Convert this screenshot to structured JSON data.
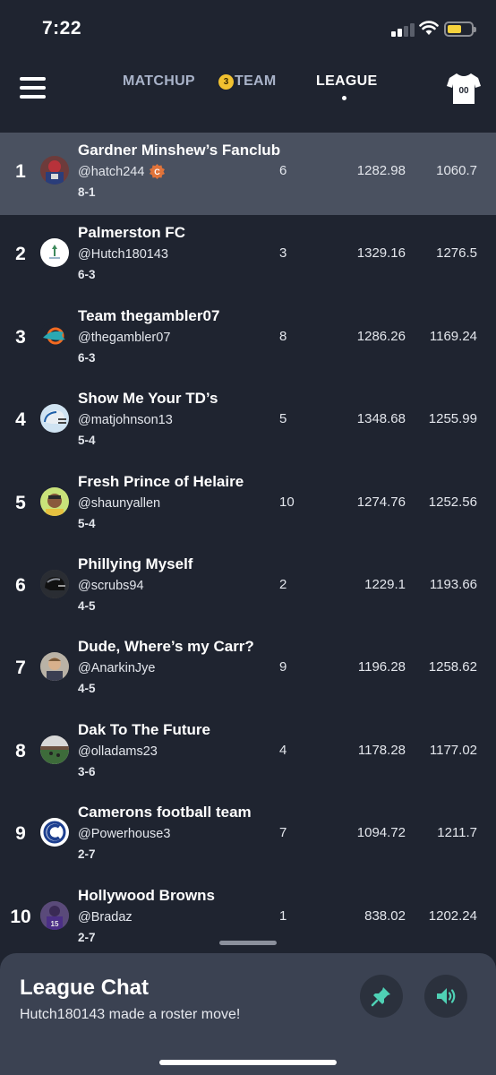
{
  "status_bar": {
    "time": "7:22"
  },
  "nav": {
    "tabs": [
      {
        "label": "MATCHUP",
        "active": false
      },
      {
        "label": "TEAM",
        "active": false,
        "badge": "3"
      },
      {
        "label": "LEAGUE",
        "active": true
      }
    ],
    "jersey_number": "00"
  },
  "colors": {
    "background": "#1f2430",
    "highlight_row": "#4a5160",
    "chat_panel": "#3b4252",
    "accent_teal": "#4fd1b5",
    "badge_yellow": "#f2c230",
    "commissioner_orange": "#e0733a"
  },
  "standings": [
    {
      "rank": "1",
      "team": "Gardner Minshew’s Fanclub",
      "handle": "@hatch244",
      "record": "8-1",
      "col_a": "6",
      "col_b": "1282.98",
      "col_c": "1060.7",
      "commissioner": true,
      "badge_letter": "C",
      "avatar": "football-player-avatar"
    },
    {
      "rank": "2",
      "team": "Palmerston FC",
      "handle": "@Hutch180143",
      "record": "6-3",
      "col_a": "3",
      "col_b": "1329.16",
      "col_c": "1276.5",
      "avatar": "club-crest-avatar"
    },
    {
      "rank": "3",
      "team": "Team thegambler07",
      "handle": "@thegambler07",
      "record": "6-3",
      "col_a": "8",
      "col_b": "1286.26",
      "col_c": "1169.24",
      "avatar": "dolphin-logo-avatar"
    },
    {
      "rank": "4",
      "team": "Show Me Your TD’s",
      "handle": "@matjohnson13",
      "record": "5-4",
      "col_a": "5",
      "col_b": "1348.68",
      "col_c": "1255.99",
      "avatar": "helmet-avatar"
    },
    {
      "rank": "5",
      "team": "Fresh Prince of Helaire",
      "handle": "@shaunyallen",
      "record": "5-4",
      "col_a": "10",
      "col_b": "1274.76",
      "col_c": "1252.56",
      "avatar": "cartoon-face-avatar"
    },
    {
      "rank": "6",
      "team": "Phillying Myself",
      "handle": "@scrubs94",
      "record": "4-5",
      "col_a": "2",
      "col_b": "1229.1",
      "col_c": "1193.66",
      "avatar": "dark-helmet-avatar"
    },
    {
      "rank": "7",
      "team": "Dude, Where’s my Carr?",
      "handle": "@AnarkinJye",
      "record": "4-5",
      "col_a": "9",
      "col_b": "1196.28",
      "col_c": "1258.62",
      "avatar": "quarterback-avatar"
    },
    {
      "rank": "8",
      "team": "Dak To The Future",
      "handle": "@olladams23",
      "record": "3-6",
      "col_a": "4",
      "col_b": "1178.28",
      "col_c": "1177.02",
      "avatar": "stadium-avatar"
    },
    {
      "rank": "9",
      "team": "Camerons football team",
      "handle": "@Powerhouse3",
      "record": "2-7",
      "col_a": "7",
      "col_b": "1094.72",
      "col_c": "1211.7",
      "avatar": "letter-c-logo-avatar"
    },
    {
      "rank": "10",
      "team": "Hollywood Browns",
      "handle": "@Bradaz",
      "record": "2-7",
      "col_a": "1",
      "col_b": "838.02",
      "col_c": "1202.24",
      "avatar": "purple-player-avatar"
    }
  ],
  "chat": {
    "title": "League Chat",
    "message": "Hutch180143 made a roster move!",
    "buttons": [
      "pin-icon",
      "speaker-icon"
    ]
  }
}
